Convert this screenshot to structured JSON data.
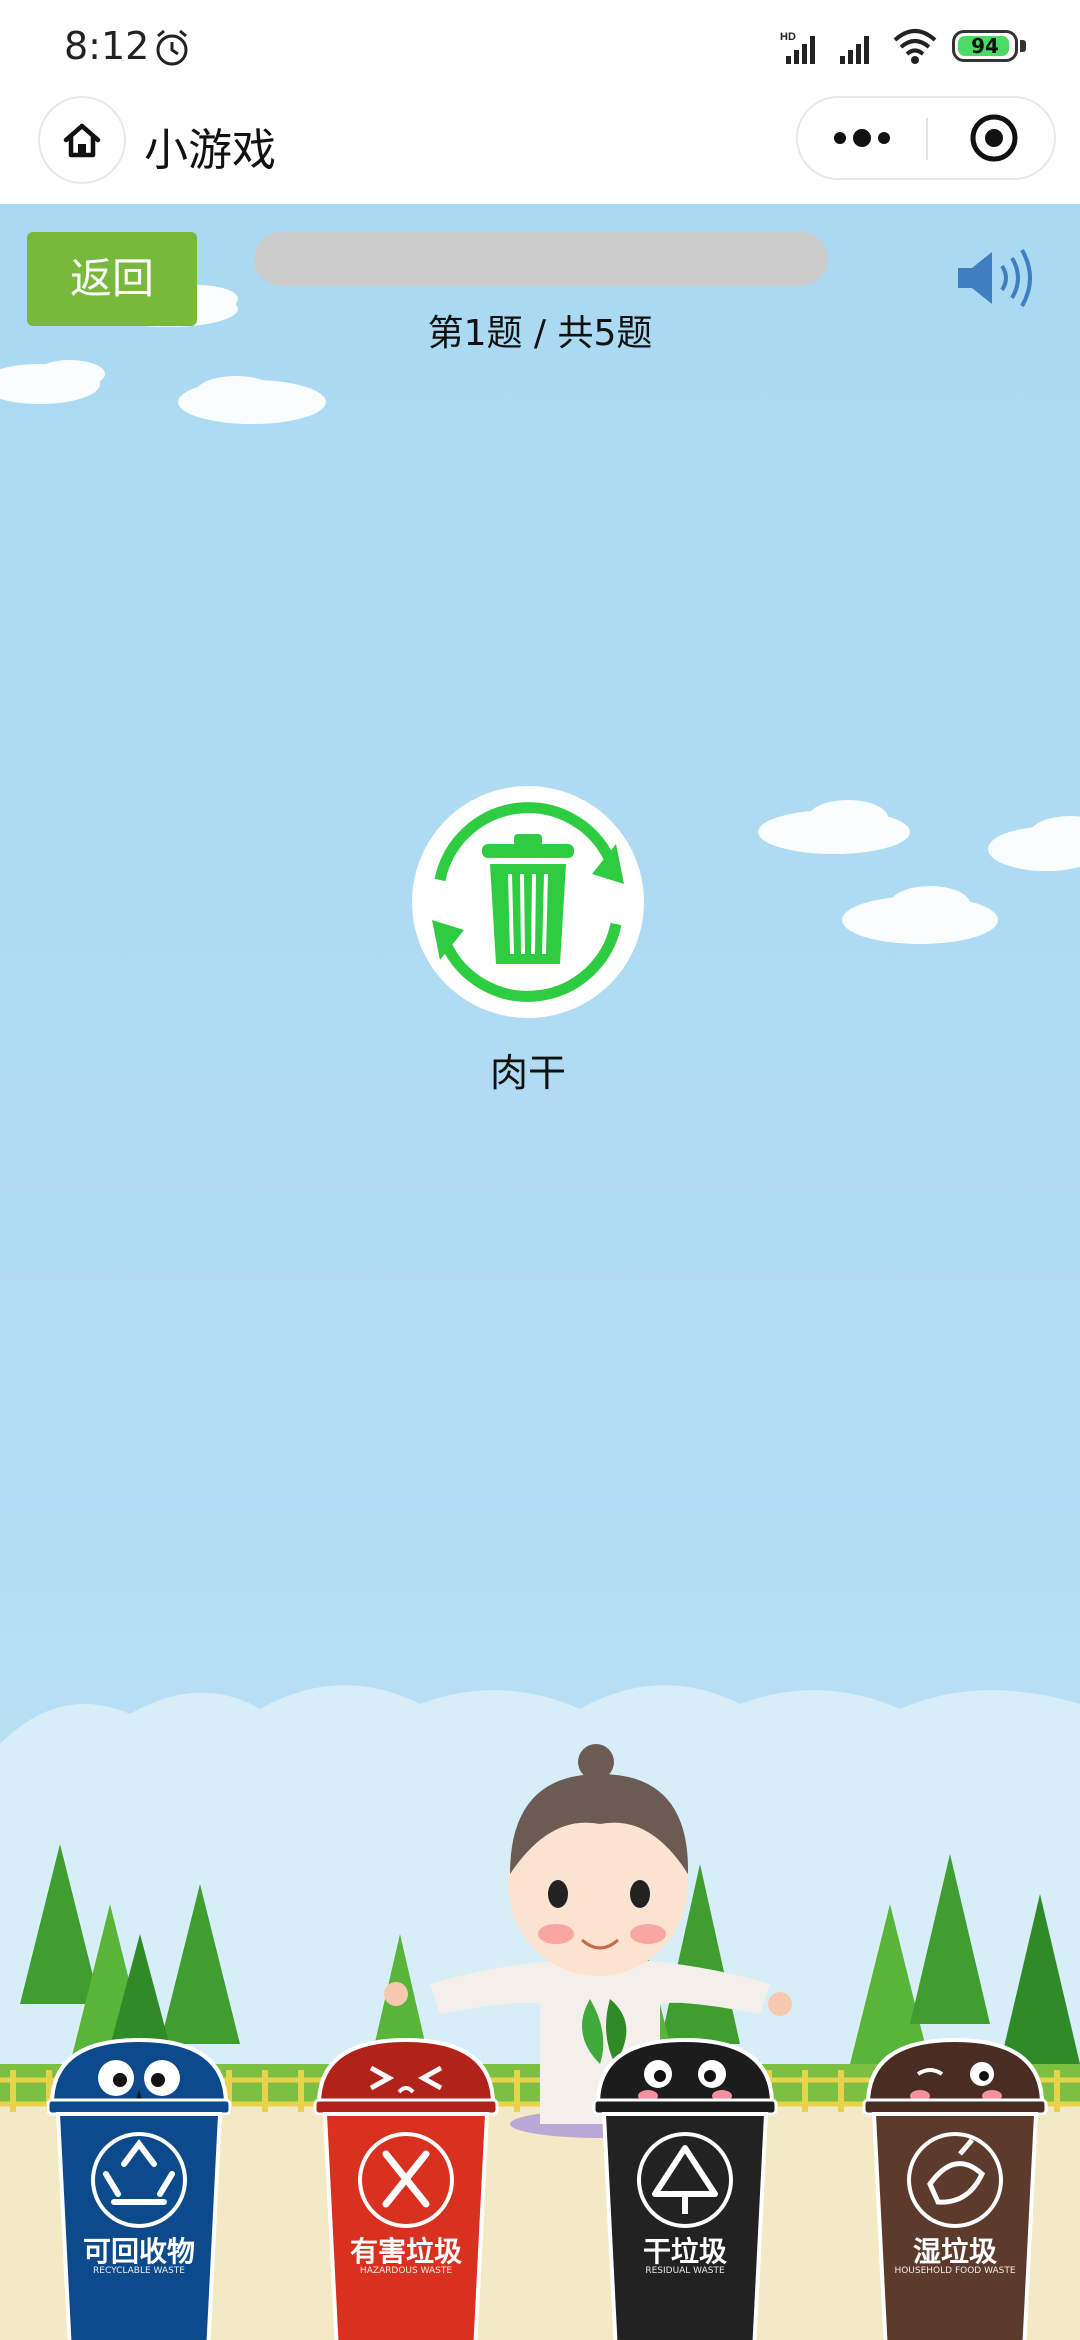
{
  "status_bar": {
    "time": "8:12",
    "battery": "94",
    "battery_level": 0.94,
    "icons": [
      "alarm-icon",
      "hd-signal-icon",
      "signal-icon",
      "wifi-icon",
      "battery-icon"
    ]
  },
  "nav": {
    "title": "小游戏",
    "icons": [
      "home-icon",
      "more-dots-icon",
      "target-icon"
    ]
  },
  "game": {
    "back_label": "返回",
    "progress": 0,
    "counter": "第1题 / 共5题",
    "item_name": "肉干",
    "icons": [
      "sound-icon",
      "trash-can-icon",
      "recycle-arrows-icon"
    ],
    "colors": {
      "sky": "#aad9f2",
      "button": "#78b83b",
      "progress_track": "#cccccc",
      "recycle_green": "#2ecc40"
    },
    "bins": [
      {
        "label": "可回收物",
        "sub": "RECYCLABLE WASTE",
        "color": "#0d4a8c",
        "icon": "recycle-icon"
      },
      {
        "label": "有害垃圾",
        "sub": "HAZARDOUS WASTE",
        "color": "#d9311f",
        "icon": "hazardous-icon"
      },
      {
        "label": "干垃圾",
        "sub": "RESIDUAL WASTE",
        "color": "#222222",
        "icon": "residual-icon"
      },
      {
        "label": "湿垃圾",
        "sub": "HOUSEHOLD FOOD WASTE",
        "color": "#5c3a2c",
        "icon": "food-waste-icon"
      }
    ]
  }
}
